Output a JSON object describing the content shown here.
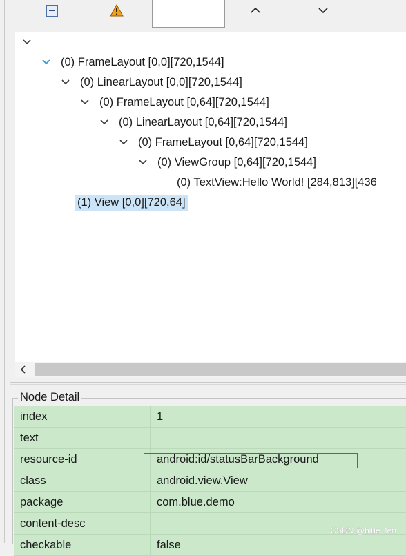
{
  "toolbar": {
    "buttons": [
      "expand-all",
      "warning",
      "up",
      "down"
    ],
    "search_value": ""
  },
  "tree": {
    "root_chevron": "⌄",
    "nodes": [
      {
        "label": "(0) FrameLayout [0,0][720,1544]",
        "expanded": true
      },
      {
        "label": "(0) LinearLayout [0,0][720,1544]",
        "expanded": true
      },
      {
        "label": "(0) FrameLayout [0,64][720,1544]",
        "expanded": true
      },
      {
        "label": "(0) LinearLayout [0,64][720,1544]",
        "expanded": true
      },
      {
        "label": "(0) FrameLayout [0,64][720,1544]",
        "expanded": true
      },
      {
        "label": "(0) ViewGroup [0,64][720,1544]",
        "expanded": true
      },
      {
        "label": "(0) TextView:Hello World! [284,813][436",
        "expanded": false
      },
      {
        "label": "(1) View [0,0][720,64]",
        "selected": true
      }
    ]
  },
  "detail": {
    "title": "Node Detail",
    "rows": [
      {
        "key": "index",
        "value": "1"
      },
      {
        "key": "text",
        "value": ""
      },
      {
        "key": "resource-id",
        "value": "android:id/statusBarBackground"
      },
      {
        "key": "class",
        "value": "android.view.View"
      },
      {
        "key": "package",
        "value": "com.blue.demo"
      },
      {
        "key": "content-desc",
        "value": ""
      },
      {
        "key": "checkable",
        "value": "false"
      }
    ]
  },
  "watermark": "CSDN @blue_fen",
  "colors": {
    "selection": "#cce4f7",
    "detail_row": "#cbe8cb",
    "highlight": "#e03030",
    "chevron_blue": "#2aa0d8"
  }
}
